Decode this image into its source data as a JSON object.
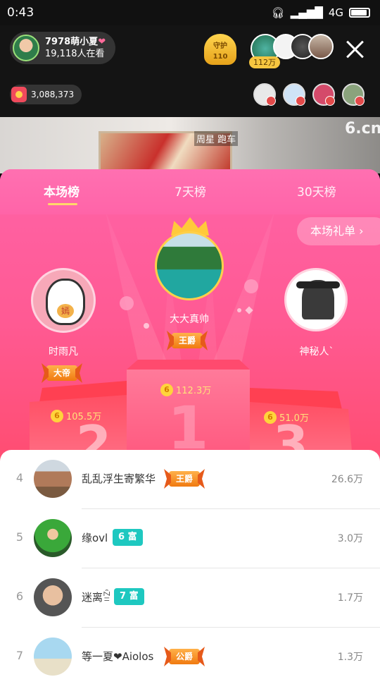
{
  "status_bar": {
    "time": "0:43",
    "network": "4G"
  },
  "host": {
    "name": "7978萌小夏",
    "viewers": "19,118人在看"
  },
  "guard": {
    "label": "守护",
    "count": "110"
  },
  "top_viewer_badge": "112万",
  "coins": "3,088,373",
  "video": {
    "tag": "周星 跑车",
    "watermark": "6.cn"
  },
  "tabs": [
    {
      "label": "本场榜",
      "active": true
    },
    {
      "label": "7天榜",
      "active": false
    },
    {
      "label": "30天榜",
      "active": false
    }
  ],
  "gift_list_button": "本场礼单",
  "top3": [
    {
      "rank": 1,
      "name": "大大真帅",
      "title": "王爵",
      "amount": "112.3万",
      "podium": "1"
    },
    {
      "rank": 2,
      "name": "时雨凡",
      "title": "大帝",
      "amount": "105.5万",
      "podium": "2"
    },
    {
      "rank": 3,
      "name": "神秘人`",
      "title": "",
      "amount": "51.0万",
      "podium": "3"
    }
  ],
  "coin_symbol": "6",
  "avatar_stamp": "嫣",
  "ranking": [
    {
      "rank": "4",
      "name": "乱乱浮生寄繁华",
      "badge": "王爵",
      "level": "",
      "amount": "26.6万"
    },
    {
      "rank": "5",
      "name": "缘ovl",
      "badge": "",
      "level": "6 富",
      "amount": "3.0万"
    },
    {
      "rank": "6",
      "name": "迷离ꊁ",
      "badge": "",
      "level": "7 富",
      "amount": "1.7万"
    },
    {
      "rank": "7",
      "name": "等一夏❤Aiolos",
      "badge": "公爵",
      "level": "",
      "amount": "1.3万"
    }
  ],
  "colors": {
    "panel_pink": "#ff63a7",
    "panel_red": "#ff4a63",
    "accent_gold": "#ffd86a",
    "level_teal": "#1ec8c0"
  }
}
